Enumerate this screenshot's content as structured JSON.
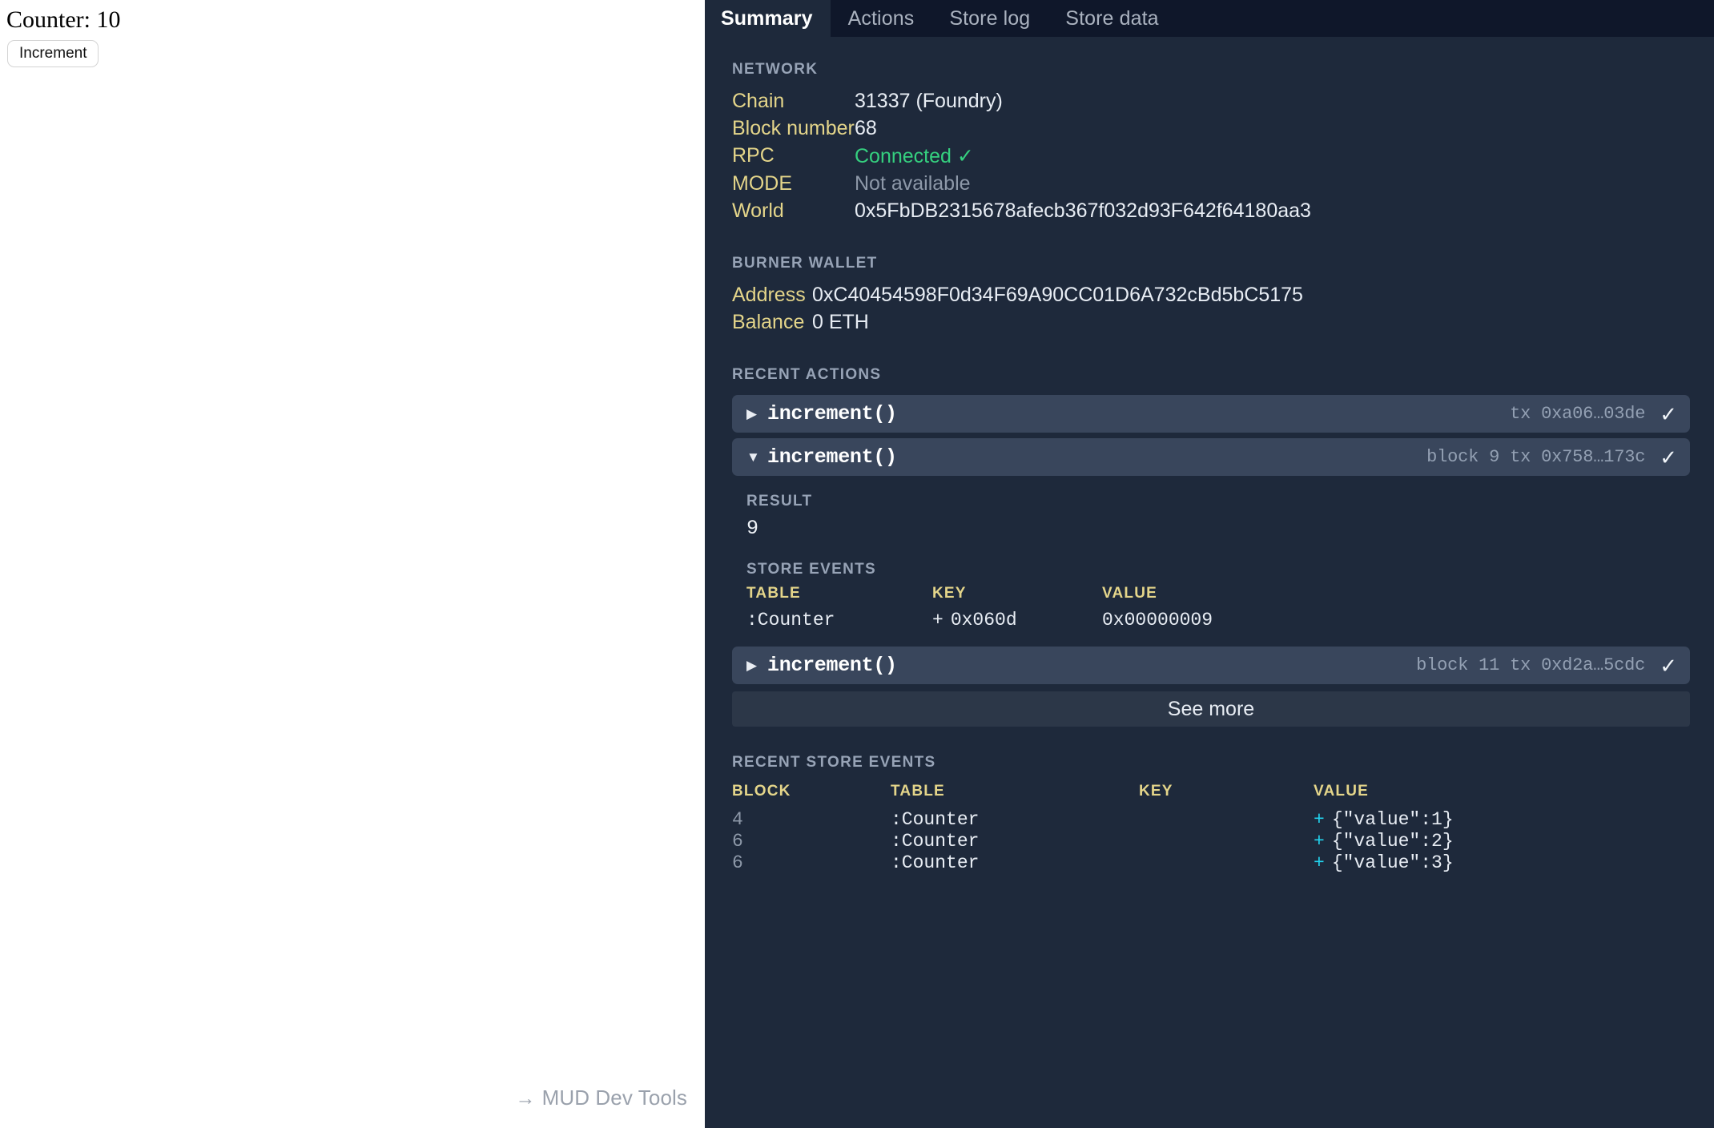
{
  "app": {
    "counter_text": "Counter: 10",
    "increment_label": "Increment",
    "devtools_link": "MUD Dev Tools",
    "devtools_arrow": "→"
  },
  "devtools": {
    "tabs": [
      {
        "label": "Summary",
        "active": true
      },
      {
        "label": "Actions",
        "active": false
      },
      {
        "label": "Store log",
        "active": false
      },
      {
        "label": "Store data",
        "active": false
      }
    ],
    "network": {
      "heading": "NETWORK",
      "rows": [
        {
          "key": "Chain",
          "value": "31337 (Foundry)",
          "style": "normal"
        },
        {
          "key": "Block number",
          "value": "68",
          "style": "normal"
        },
        {
          "key": "RPC",
          "value": "Connected ✓",
          "style": "ok"
        },
        {
          "key": "MODE",
          "value": "Not available",
          "style": "muted"
        },
        {
          "key": "World",
          "value": "0x5FbDB2315678afecb367f032d93F642f64180aa3",
          "style": "normal"
        }
      ]
    },
    "burner_wallet": {
      "heading": "BURNER WALLET",
      "rows": [
        {
          "key": "Address",
          "value": "0xC40454598F0d34F69A90CC01D6A732cBd5bC5175"
        },
        {
          "key": "Balance",
          "value": "0 ETH"
        }
      ]
    },
    "recent_actions": {
      "heading": "RECENT ACTIONS",
      "see_more_label": "See more",
      "items": [
        {
          "caret": "▶",
          "name": "increment()",
          "meta": "tx 0xa06…03de",
          "status": "✓",
          "expanded": false
        },
        {
          "caret": "▼",
          "name": "increment()",
          "meta": "block 9 tx 0x758…173c",
          "status": "✓",
          "expanded": true,
          "result_label": "RESULT",
          "result_value": "9",
          "store_events_label": "STORE EVENTS",
          "store_events_headers": [
            "TABLE",
            "KEY",
            "VALUE"
          ],
          "store_events_rows": [
            {
              "table": ":Counter",
              "key_sign": "+",
              "key": "0x060d",
              "value": "0x00000009"
            }
          ]
        },
        {
          "caret": "▶",
          "name": "increment()",
          "meta": "block 11 tx 0xd2a…5cdc",
          "status": "✓",
          "expanded": false
        }
      ]
    },
    "recent_store_events": {
      "heading": "RECENT STORE EVENTS",
      "headers": [
        "BLOCK",
        "TABLE",
        "KEY",
        "VALUE"
      ],
      "rows": [
        {
          "block": "4",
          "table": ":Counter",
          "key": "",
          "value_sign": "+",
          "value": "{\"value\":1}"
        },
        {
          "block": "6",
          "table": ":Counter",
          "key": "",
          "value_sign": "+",
          "value": "{\"value\":2}"
        },
        {
          "block": "6",
          "table": ":Counter",
          "key": "",
          "value_sign": "+",
          "value": "{\"value\":3}"
        }
      ]
    }
  },
  "colors": {
    "panel_bg": "#1e293b",
    "tabbar_bg": "#0f172a",
    "row_bg": "#39465c",
    "key_yellow": "#e4d58a",
    "ok_green": "#35d07f",
    "plus_cyan": "#22d3ee",
    "muted": "#8d98a8"
  }
}
